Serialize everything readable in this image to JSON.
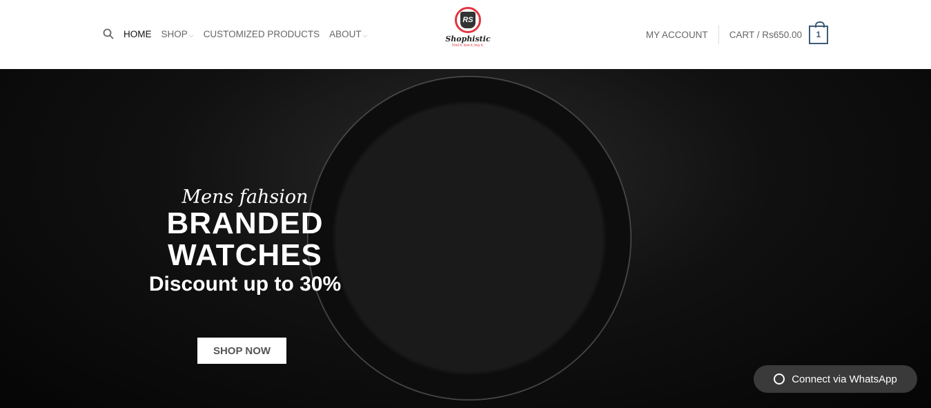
{
  "nav": {
    "home": "HOME",
    "shop": "SHOP",
    "customized": "CUSTOMIZED PRODUCTS",
    "about": "ABOUT",
    "chevron": "⌵"
  },
  "logo": {
    "monogram": "RS",
    "name": "Shophistic",
    "tagline": "Find it, love it, buy it."
  },
  "account": {
    "my_account": "MY ACCOUNT",
    "cart": "CART / Rs650.00",
    "cart_count": "1"
  },
  "hero": {
    "script": "Mens fahsion",
    "line1": "BRANDED",
    "line2": "WATCHES",
    "discount": "Discount up to  30%",
    "cta": "SHOP NOW"
  },
  "whatsapp": {
    "label": "Connect via WhatsApp"
  }
}
